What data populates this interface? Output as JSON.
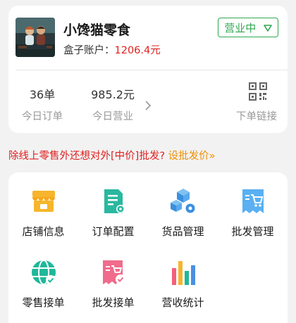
{
  "store": {
    "name": "小馋猫零食",
    "balance_label": "盒子账户：",
    "balance_value": "1206.4元",
    "status_label": "营业中"
  },
  "stats": {
    "orders_value": "36单",
    "orders_label": "今日订单",
    "revenue_value": "985.2元",
    "revenue_label": "今日营业",
    "order_link_label": "下单链接"
  },
  "promo": {
    "text": "除线上零售外还想对外[中价]批发?",
    "cta": "设批发价»"
  },
  "menu": [
    {
      "label": "店铺信息",
      "icon": "store-icon"
    },
    {
      "label": "订单配置",
      "icon": "order-settings-icon"
    },
    {
      "label": "货品管理",
      "icon": "goods-management-icon"
    },
    {
      "label": "批发管理",
      "icon": "wholesale-management-icon"
    },
    {
      "label": "零售接单",
      "icon": "retail-orders-icon"
    },
    {
      "label": "批发接单",
      "icon": "wholesale-orders-icon"
    },
    {
      "label": "营收统计",
      "icon": "revenue-stats-icon"
    }
  ],
  "colors": {
    "status_green": "#2fa84f",
    "balance_red": "#e02020",
    "cta_orange": "#f09000"
  }
}
